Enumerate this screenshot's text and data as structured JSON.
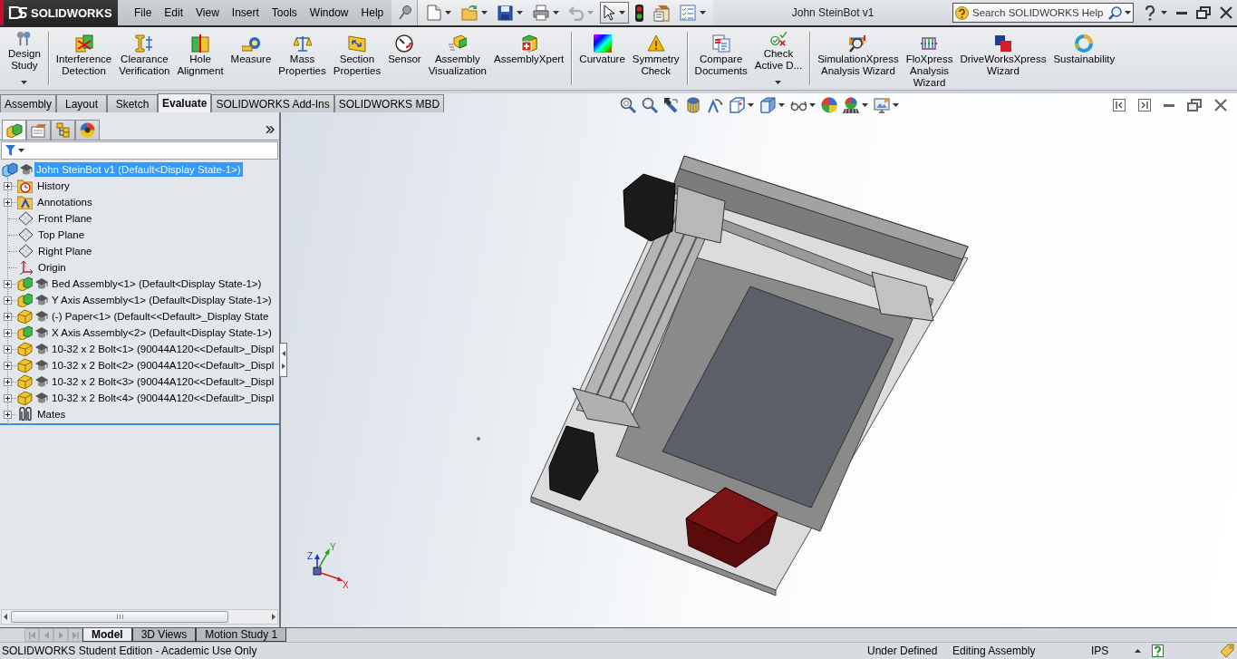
{
  "window": {
    "title": "John SteinBot v1"
  },
  "logo": {
    "text": "SOLIDWORKS"
  },
  "menu": [
    "File",
    "Edit",
    "View",
    "Insert",
    "Tools",
    "Window",
    "Help"
  ],
  "quick_access": [
    {
      "dropdown": true,
      "pressed": false,
      "disabled": false
    },
    {
      "dropdown": true,
      "pressed": false,
      "disabled": false
    },
    {
      "dropdown": true,
      "pressed": false,
      "disabled": false
    },
    {
      "dropdown": true,
      "pressed": false,
      "disabled": false
    },
    {
      "dropdown": true,
      "pressed": false,
      "disabled": true
    },
    {
      "dropdown": true,
      "pressed": true,
      "disabled": false
    },
    {
      "dropdown": false,
      "pressed": false,
      "disabled": false
    },
    {
      "dropdown": false,
      "pressed": false,
      "disabled": false
    },
    {
      "dropdown": true,
      "pressed": false,
      "disabled": false
    }
  ],
  "search": {
    "placeholder": "Search SOLIDWORKS Help"
  },
  "ribbon": {
    "groups": [
      {
        "items": [
          {
            "label": [
              "Design",
              "Study"
            ],
            "dropdown": true
          }
        ]
      },
      {
        "items": [
          {
            "label": [
              "Interference",
              "Detection"
            ],
            "dropdown": false
          },
          {
            "label": [
              "Clearance",
              "Verification"
            ],
            "dropdown": false
          },
          {
            "label": [
              "Hole",
              "Alignment"
            ],
            "dropdown": false
          },
          {
            "label": [
              "Measure"
            ],
            "dropdown": false
          },
          {
            "label": [
              "Mass",
              "Properties"
            ],
            "dropdown": false
          },
          {
            "label": [
              "Section",
              "Properties"
            ],
            "dropdown": false
          },
          {
            "label": [
              "Sensor"
            ],
            "dropdown": false
          },
          {
            "label": [
              "Assembly",
              "Visualization"
            ],
            "dropdown": false
          },
          {
            "label": [
              "AssemblyXpert"
            ],
            "dropdown": false
          }
        ]
      },
      {
        "items": [
          {
            "label": [
              "Curvature"
            ],
            "dropdown": false
          },
          {
            "label": [
              "Symmetry",
              "Check"
            ],
            "dropdown": false
          }
        ]
      },
      {
        "items": [
          {
            "label": [
              "Compare",
              "Documents"
            ],
            "dropdown": false
          },
          {
            "label": [
              "Check",
              "Active D..."
            ],
            "dropdown": true
          }
        ]
      },
      {
        "items": [
          {
            "label": [
              "SimulationXpress",
              "Analysis Wizard"
            ],
            "dropdown": false
          },
          {
            "label": [
              "FloXpress",
              "Analysis",
              "Wizard"
            ],
            "dropdown": false
          },
          {
            "label": [
              "DriveWorksXpress",
              "Wizard"
            ],
            "dropdown": false
          },
          {
            "label": [
              "Sustainability"
            ],
            "dropdown": false
          }
        ]
      }
    ]
  },
  "command_tabs": [
    {
      "label": "Assembly",
      "selected": false
    },
    {
      "label": "Layout",
      "selected": false
    },
    {
      "label": "Sketch",
      "selected": false
    },
    {
      "label": "Evaluate",
      "selected": true
    },
    {
      "label": "SOLIDWORKS Add-Ins",
      "selected": false
    },
    {
      "label": "SOLIDWORKS MBD",
      "selected": false
    }
  ],
  "panel_tabs": [
    {
      "selected": true
    },
    {
      "selected": false
    },
    {
      "selected": false
    },
    {
      "selected": false
    }
  ],
  "feature_tree": {
    "root": {
      "label": "John SteinBot v1 (Default<Display State-1>)",
      "selected": true,
      "children": [
        {
          "kind": "history",
          "label": "History",
          "expandable": true,
          "selected": false
        },
        {
          "kind": "annotations",
          "label": "Annotations",
          "expandable": true,
          "selected": false
        },
        {
          "kind": "plane",
          "label": "Front Plane",
          "expandable": false,
          "selected": false
        },
        {
          "kind": "plane",
          "label": "Top Plane",
          "expandable": false,
          "selected": false
        },
        {
          "kind": "plane",
          "label": "Right Plane",
          "expandable": false,
          "selected": false
        },
        {
          "kind": "origin",
          "label": "Origin",
          "expandable": false,
          "selected": false
        },
        {
          "kind": "assembly",
          "label": "Bed Assembly<1> (Default<Display State-1>)",
          "expandable": true,
          "selected": false
        },
        {
          "kind": "assembly",
          "label": "Y Axis Assembly<1> (Default<Display State-1>)",
          "expandable": true,
          "selected": false
        },
        {
          "kind": "part",
          "label": "(-) Paper<1> (Default<<Default>_Display State",
          "expandable": true,
          "selected": false
        },
        {
          "kind": "assembly",
          "label": "X Axis Assembly<2> (Default<Display State-1>)",
          "expandable": true,
          "selected": false
        },
        {
          "kind": "part",
          "label": "10-32 x 2 Bolt<1> (90044A120<<Default>_Displ",
          "expandable": true,
          "selected": false
        },
        {
          "kind": "part",
          "label": "10-32 x 2 Bolt<2> (90044A120<<Default>_Displ",
          "expandable": true,
          "selected": false
        },
        {
          "kind": "part",
          "label": "10-32 x 2 Bolt<3> (90044A120<<Default>_Displ",
          "expandable": true,
          "selected": false
        },
        {
          "kind": "part",
          "label": "10-32 x 2 Bolt<4> (90044A120<<Default>_Displ",
          "expandable": true,
          "selected": false
        },
        {
          "kind": "mates",
          "label": "Mates",
          "expandable": true,
          "selected": false
        }
      ]
    }
  },
  "view_toolbar": [
    {
      "dropdown": false
    },
    {
      "dropdown": false
    },
    {
      "dropdown": false
    },
    {
      "dropdown": false
    },
    {
      "dropdown": false
    },
    {
      "dropdown": true
    },
    {
      "dropdown": true
    },
    {
      "dropdown": true
    },
    {
      "dropdown": false
    },
    {
      "dropdown": true
    },
    {
      "dropdown": true
    }
  ],
  "triad": {
    "x": "X",
    "y": "Y",
    "z": "Z"
  },
  "bottom_tabs": [
    {
      "label": "Model",
      "selected": true
    },
    {
      "label": "3D Views",
      "selected": false
    },
    {
      "label": "Motion Study 1",
      "selected": false
    }
  ],
  "status_bar": {
    "message": "SOLIDWORKS Student Edition - Academic Use Only",
    "fields": [
      "Under Defined",
      "Editing Assembly",
      "IPS"
    ]
  }
}
